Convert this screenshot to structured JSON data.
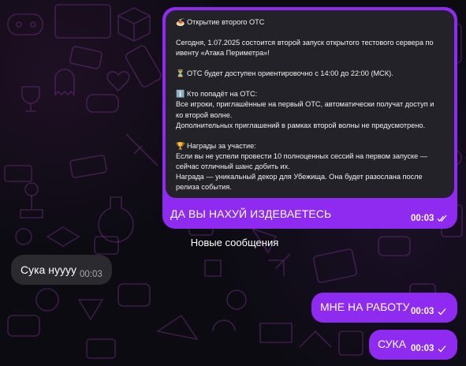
{
  "quoted_post": {
    "title": "🍝 Открытие второго ОТС",
    "p1": "Сегодня, 1.07.2025 состоится второй запуск открытого тестового сервера по ивенту «Атака Периметра»!",
    "p2": "⏳ ОТС будет доступен ориентировочно с 14:00 до 22:00 (МСК).",
    "p3_title": "ℹ️ Кто попадёт на ОТС:",
    "p3_line1": "Все игроки, приглашённые на первый ОТС, автоматически получат доступ и",
    "p3_line2": "ко второй волне.",
    "p3_line3": "Дополнительных приглашений в рамках второй волны не предусмотрено.",
    "p4_title": "🏆 Награды за участие:",
    "p4_line1": "Если вы не успели провести 10 полноценных сессий на первом запуске —",
    "p4_line2": "сейчас отличный шанс добить их.",
    "p4_line3": "Награда — уникальный декор для Убежища. Она будет разослана после",
    "p4_line4": "релиза события."
  },
  "messages": {
    "reply_text": "ДА ВЫ НАХУЙ ИЗДЕВАЕТЕСЬ",
    "reply_time": "00:03",
    "divider": "Новые сообщения",
    "incoming_text": "Сука нуууу",
    "incoming_time": "00:03",
    "out1_text": "МНЕ НА РАБОТУ",
    "out1_time": "00:03",
    "out2_text": "СУКА",
    "out2_time": "00:03"
  },
  "colors": {
    "outgoing_bubble": "#8f2bf0",
    "incoming_bubble": "#2b2a2e",
    "quote_bg": "#222228"
  }
}
